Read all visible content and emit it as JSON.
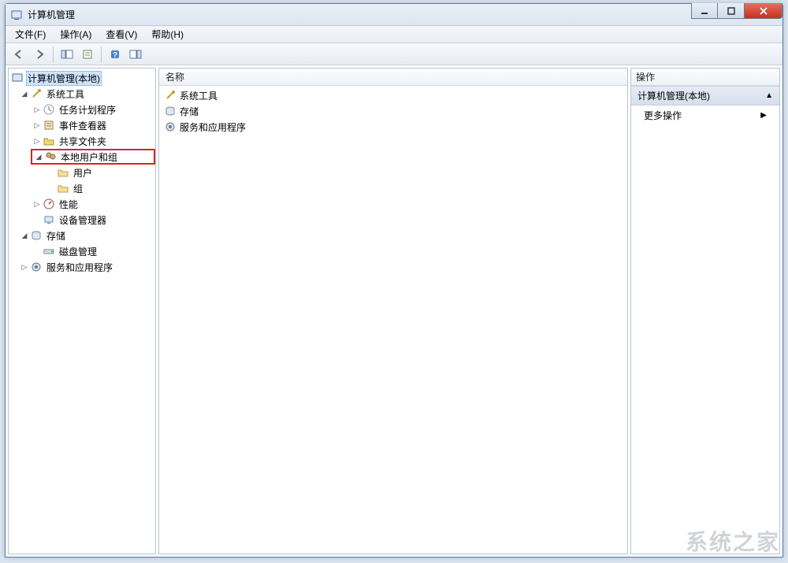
{
  "window": {
    "title": "计算机管理"
  },
  "menu": {
    "file": "文件(F)",
    "action": "操作(A)",
    "view": "查看(V)",
    "help": "帮助(H)"
  },
  "left_header": "计算机管理(本地)",
  "tree": {
    "root": "计算机管理(本地)",
    "system_tools": "系统工具",
    "task_scheduler": "任务计划程序",
    "event_viewer": "事件查看器",
    "shared_folders": "共享文件夹",
    "local_users_groups": "本地用户和组",
    "users": "用户",
    "groups": "组",
    "performance": "性能",
    "device_manager": "设备管理器",
    "storage": "存储",
    "disk_management": "磁盘管理",
    "services_apps": "服务和应用程序"
  },
  "mid_header": "名称",
  "mid_items": {
    "system_tools": "系统工具",
    "storage": "存储",
    "services_apps": "服务和应用程序"
  },
  "right": {
    "header": "操作",
    "context": "计算机管理(本地)",
    "more_actions": "更多操作"
  },
  "watermark": "系统之家"
}
